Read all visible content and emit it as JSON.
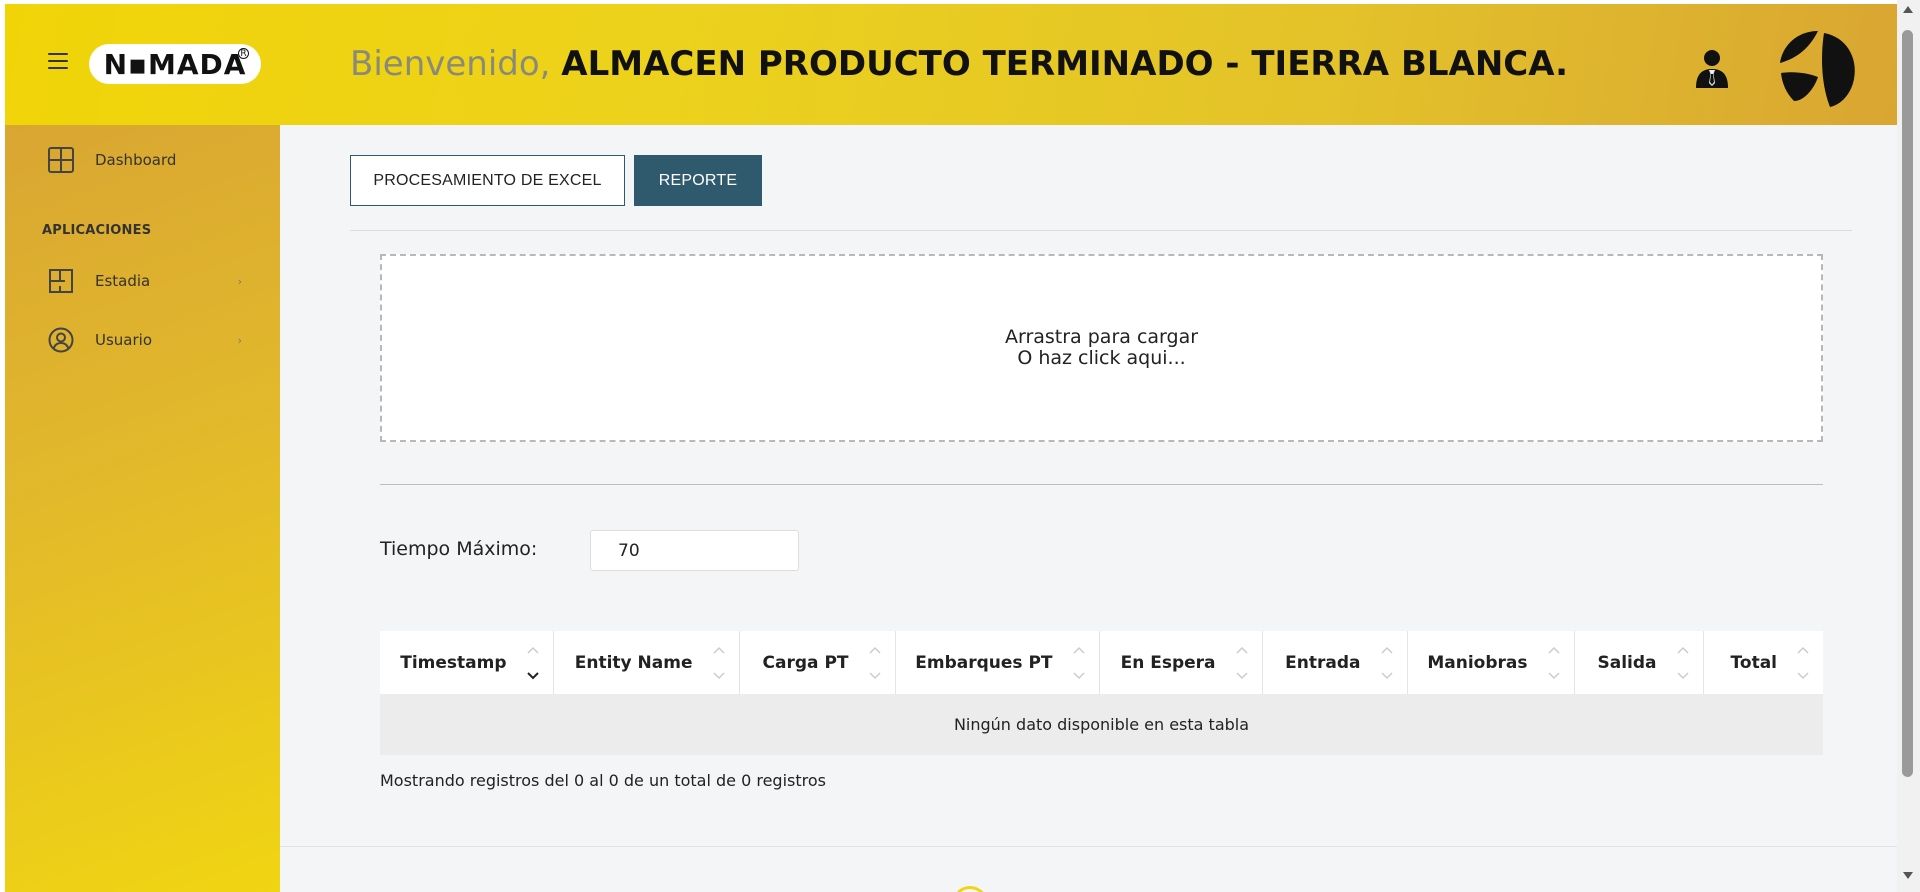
{
  "header": {
    "logo_text": "N▪MADA",
    "logo_reg": "R",
    "welcome_prefix": "Bienvenido, ",
    "welcome_name": "ALMACEN PRODUCTO TERMINADO - TIERRA BLANCA."
  },
  "sidebar": {
    "items": [
      {
        "label": "Dashboard",
        "icon": "dashboard-grid-icon"
      }
    ],
    "section_label": "APLICACIONES",
    "apps": [
      {
        "label": "Estadia",
        "icon": "floorplan-icon",
        "chevron": "›"
      },
      {
        "label": "Usuario",
        "icon": "user-circle-icon",
        "chevron": "›"
      }
    ]
  },
  "main": {
    "buttons": {
      "excel": "PROCESAMIENTO DE EXCEL",
      "reporte": "REPORTE"
    },
    "dropzone": {
      "line1": "Arrastra para cargar",
      "line2": "O haz click aqui..."
    },
    "tiempo_label": "Tiempo Máximo:",
    "tiempo_value": "70",
    "table": {
      "columns": [
        "Timestamp",
        "Entity Name",
        "Carga PT",
        "Embarques PT",
        "En Espera",
        "Entrada",
        "Maniobras",
        "Salida",
        "Total"
      ],
      "sorted_column": "Timestamp",
      "empty_message": "Ningún dato disponible en esta tabla"
    },
    "info": "Mostrando registros del 0 al 0 de un total de 0 registros"
  },
  "colors": {
    "primary_button": "#2f5a6e",
    "header_gold": "#f1d408",
    "sidebar_gold": "#d9a632"
  }
}
